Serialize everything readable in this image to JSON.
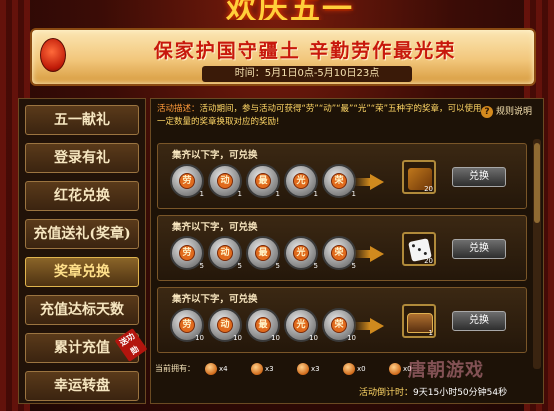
{
  "header": {
    "title": "欢庆五一",
    "slogan": "保家护国守疆土  辛勤劳作最光荣",
    "time": "时间：5月1日0点-5月10日23点"
  },
  "sidebar": {
    "items": [
      {
        "label": "五一献礼"
      },
      {
        "label": "登录有礼"
      },
      {
        "label": "红花兑换"
      },
      {
        "label": "充值送礼(奖章)"
      },
      {
        "label": "奖章兑换"
      },
      {
        "label": "充值达标天数"
      },
      {
        "label": "累计充值"
      },
      {
        "label": "幸运转盘"
      }
    ],
    "active_index": 4,
    "badge": "送功勋"
  },
  "main": {
    "desc_label": "活动描述：",
    "desc_text": "活动期间，参与活动可获得“劳”“动”“最”“光”“荣”五种字的奖章，可以使用一定数量的奖章换取对应的奖励!",
    "rules_label": "规则说明",
    "cards": [
      {
        "title": "集齐以下字，可兑换",
        "coins": [
          {
            "char": "劳",
            "count": "1"
          },
          {
            "char": "动",
            "count": "1"
          },
          {
            "char": "最",
            "count": "1"
          },
          {
            "char": "光",
            "count": "1"
          },
          {
            "char": "荣",
            "count": "1"
          }
        ],
        "prize": {
          "icon": "tome-bundle-icon",
          "count": "20"
        },
        "button": "兑换"
      },
      {
        "title": "集齐以下字，可兑换",
        "coins": [
          {
            "char": "劳",
            "count": "5"
          },
          {
            "char": "动",
            "count": "5"
          },
          {
            "char": "最",
            "count": "5"
          },
          {
            "char": "光",
            "count": "5"
          },
          {
            "char": "荣",
            "count": "5"
          }
        ],
        "prize": {
          "icon": "dice-icon",
          "count": "20"
        },
        "button": "兑换"
      },
      {
        "title": "集齐以下字，可兑换",
        "coins": [
          {
            "char": "劳",
            "count": "10"
          },
          {
            "char": "动",
            "count": "10"
          },
          {
            "char": "最",
            "count": "10"
          },
          {
            "char": "光",
            "count": "10"
          },
          {
            "char": "荣",
            "count": "10"
          }
        ],
        "prize": {
          "icon": "treasure-chest-icon",
          "count": "1"
        },
        "button": "兑换"
      }
    ],
    "owned_label": "当前拥有：",
    "owned": [
      {
        "char": "劳",
        "count": "x4"
      },
      {
        "char": "动",
        "count": "x3"
      },
      {
        "char": "最",
        "count": "x3"
      },
      {
        "char": "光",
        "count": "x0"
      },
      {
        "char": "荣",
        "count": "x0"
      }
    ],
    "countdown_label": "活动倒计时：",
    "countdown_value": "9天15小时50分钟54秒"
  },
  "watermark": "唐朝游戏",
  "colors": {
    "accent": "#ffd766",
    "slogan": "#c8180c",
    "panel": "#1d1207"
  }
}
